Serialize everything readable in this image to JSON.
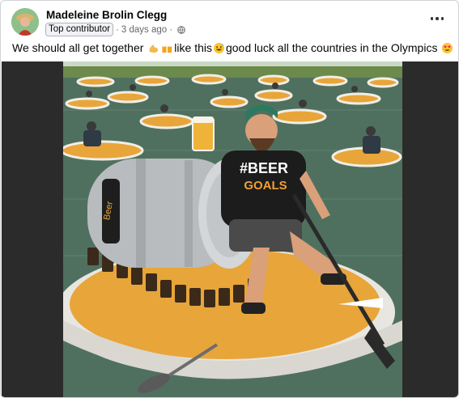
{
  "post": {
    "author": "Madeleine Brolin Clegg",
    "badge": "Top contributor",
    "time": "3 days ago",
    "separator": "·",
    "privacy_icon": "globe-icon",
    "menu_icon": "more-horizontal-icon",
    "text": {
      "part1": "We should all get together",
      "part2": "like this",
      "part3": "good luck all the countries in the Olympics"
    },
    "emojis": [
      "flexed-biceps-emoji",
      "clinking-beer-mugs-emoji",
      "grinning-sweat-emoji",
      "heart-eyes-emoji"
    ]
  },
  "image": {
    "description_icon": "photo",
    "shirt_text_line1": "#BEER",
    "shirt_text_line2": "GOALS",
    "keg_brand": "Beer"
  },
  "colors": {
    "frame_bg": "#2b2b2b",
    "water": "#4d6a5a",
    "boat_deck": "#e8a53a",
    "boat_hull": "#e8e6e0"
  }
}
